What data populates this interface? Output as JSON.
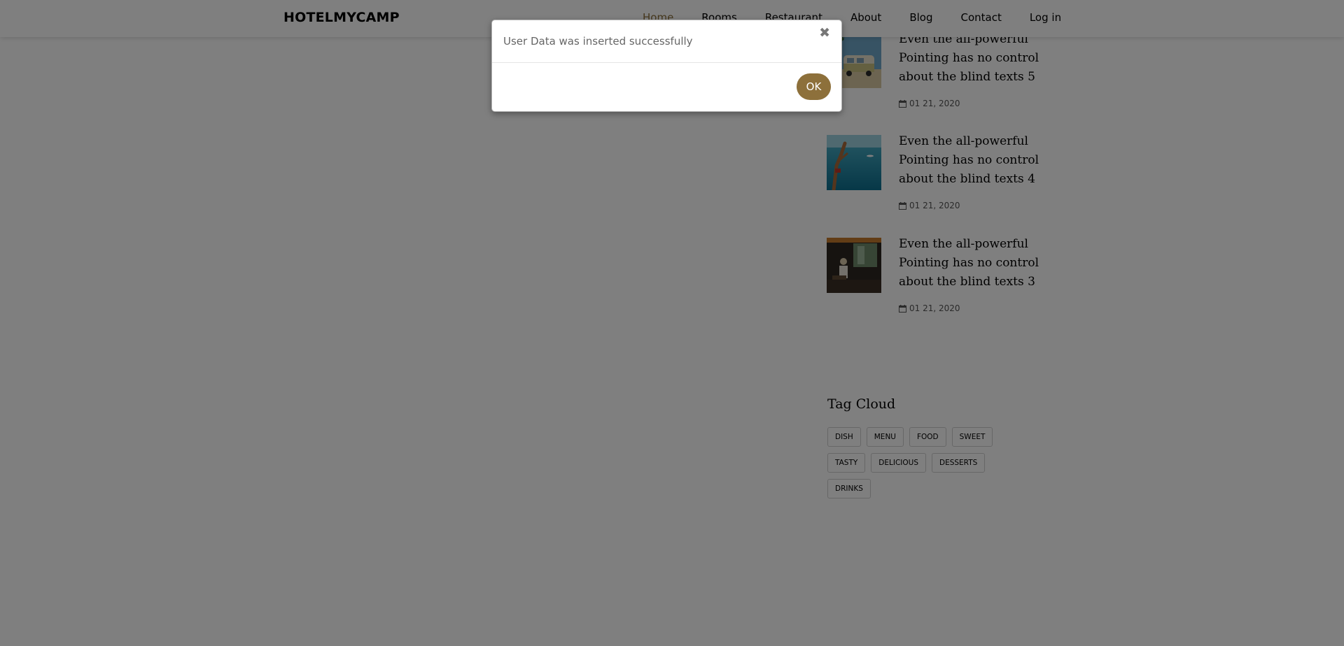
{
  "navbar": {
    "brand": "HOTELMYCAMP",
    "links": [
      {
        "label": "Home",
        "active": true
      },
      {
        "label": "Rooms",
        "active": false
      },
      {
        "label": "Restaurant",
        "active": false
      },
      {
        "label": "About",
        "active": false
      },
      {
        "label": "Blog",
        "active": false
      },
      {
        "label": "Contact",
        "active": false
      },
      {
        "label": "Log in",
        "active": false
      }
    ]
  },
  "sidebar": {
    "posts": [
      {
        "title": "Even the all-powerful Pointing has no control about the blind texts 5",
        "date": "01 21, 2020",
        "thumb": "van-palm-photo"
      },
      {
        "title": "Even the all-powerful Pointing has no control about the blind texts 4",
        "date": "01 21, 2020",
        "thumb": "sea-diver-photo"
      },
      {
        "title": "Even the all-powerful Pointing has no control about the blind texts 3",
        "date": "01 21, 2020",
        "thumb": "restaurant-interior-photo"
      }
    ],
    "tag_cloud": {
      "title": "Tag Cloud",
      "tags": [
        "DISH",
        "MENU",
        "FOOD",
        "SWEET",
        "TASTY",
        "DELICIOUS",
        "DESSERTS",
        "DRINKS"
      ]
    }
  },
  "modal": {
    "message": "User Data was inserted successfully",
    "close_symbol": "✖",
    "ok_label": "OK"
  },
  "colors": {
    "accent": "#8d703b",
    "overlay": "rgba(0,0,0,0.5)"
  }
}
